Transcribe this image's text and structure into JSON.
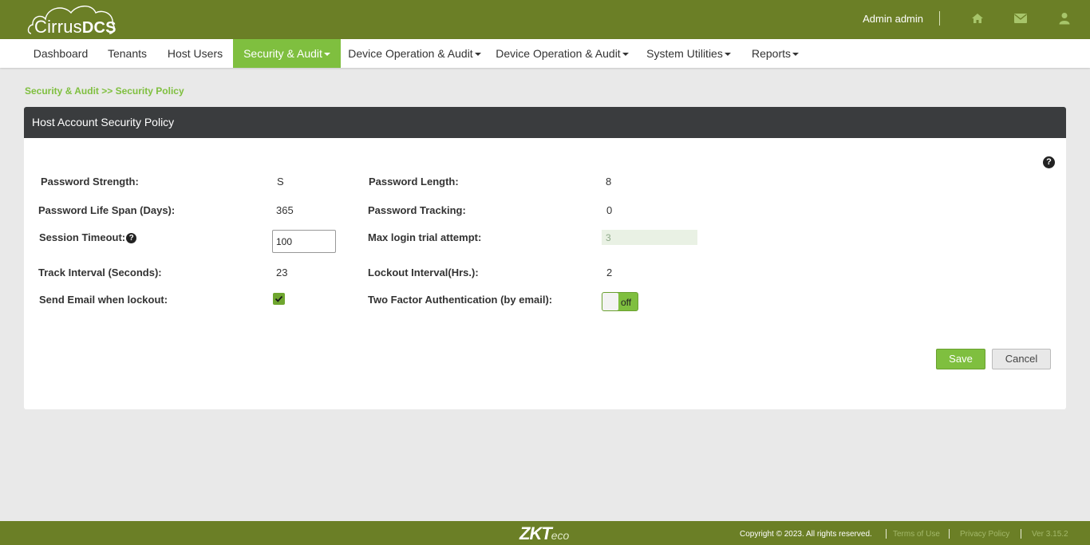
{
  "brand": {
    "logo_main": "Cirrus",
    "logo_bold": "DCS"
  },
  "header": {
    "user_name": "Admin admin",
    "icons": [
      "home-icon",
      "envelope-icon",
      "user-icon"
    ]
  },
  "nav": {
    "items": [
      {
        "label": "Dashboard",
        "dropdown": false
      },
      {
        "label": "Tenants",
        "dropdown": false
      },
      {
        "label": "Host Users",
        "dropdown": false
      },
      {
        "label": "Security & Audit",
        "dropdown": true,
        "active": true
      },
      {
        "label": "Device Operation & Audit",
        "dropdown": true
      },
      {
        "label": "Device Operation & Audit",
        "dropdown": true
      },
      {
        "label": "System Utilities",
        "dropdown": true
      },
      {
        "label": "Reports",
        "dropdown": true
      }
    ]
  },
  "breadcrumb": "Security & Audit >> Security Policy",
  "panel": {
    "title": "Host Account Security Policy",
    "help": "?"
  },
  "form": {
    "password_strength_label": "Password Strength:",
    "password_strength_value": "S",
    "password_length_label": "Password Length:",
    "password_length_value": "8",
    "life_span_label": "Password Life Span (Days):",
    "life_span_value": "365",
    "tracking_label": "Password Tracking:",
    "tracking_value": "0",
    "session_timeout_label": "Session Timeout:",
    "session_timeout_help": "?",
    "session_timeout_value": "100",
    "max_login_label": "Max login trial attempt:",
    "max_login_value": "3",
    "track_interval_label": "Track Interval (Seconds):",
    "track_interval_value": "23",
    "lockout_interval_label": "Lockout Interval(Hrs.):",
    "lockout_interval_value": "2",
    "send_email_label": "Send Email when lockout:",
    "send_email_checked": true,
    "two_factor_label": "Two Factor Authentication (by email):",
    "two_factor_state": "off"
  },
  "buttons": {
    "save": "Save",
    "cancel": "Cancel"
  },
  "footer": {
    "logo_main": "ZKT",
    "logo_sub": "eco",
    "copyright": "Copyright © 2023. All rights reserved.",
    "terms": "Terms of Use",
    "privacy": "Privacy Policy",
    "version": "Ver 3.15.2"
  },
  "colors": {
    "brand_green": "#6b7f26",
    "accent_green": "#7fbf3f",
    "panel_header": "#3a3c3e"
  }
}
